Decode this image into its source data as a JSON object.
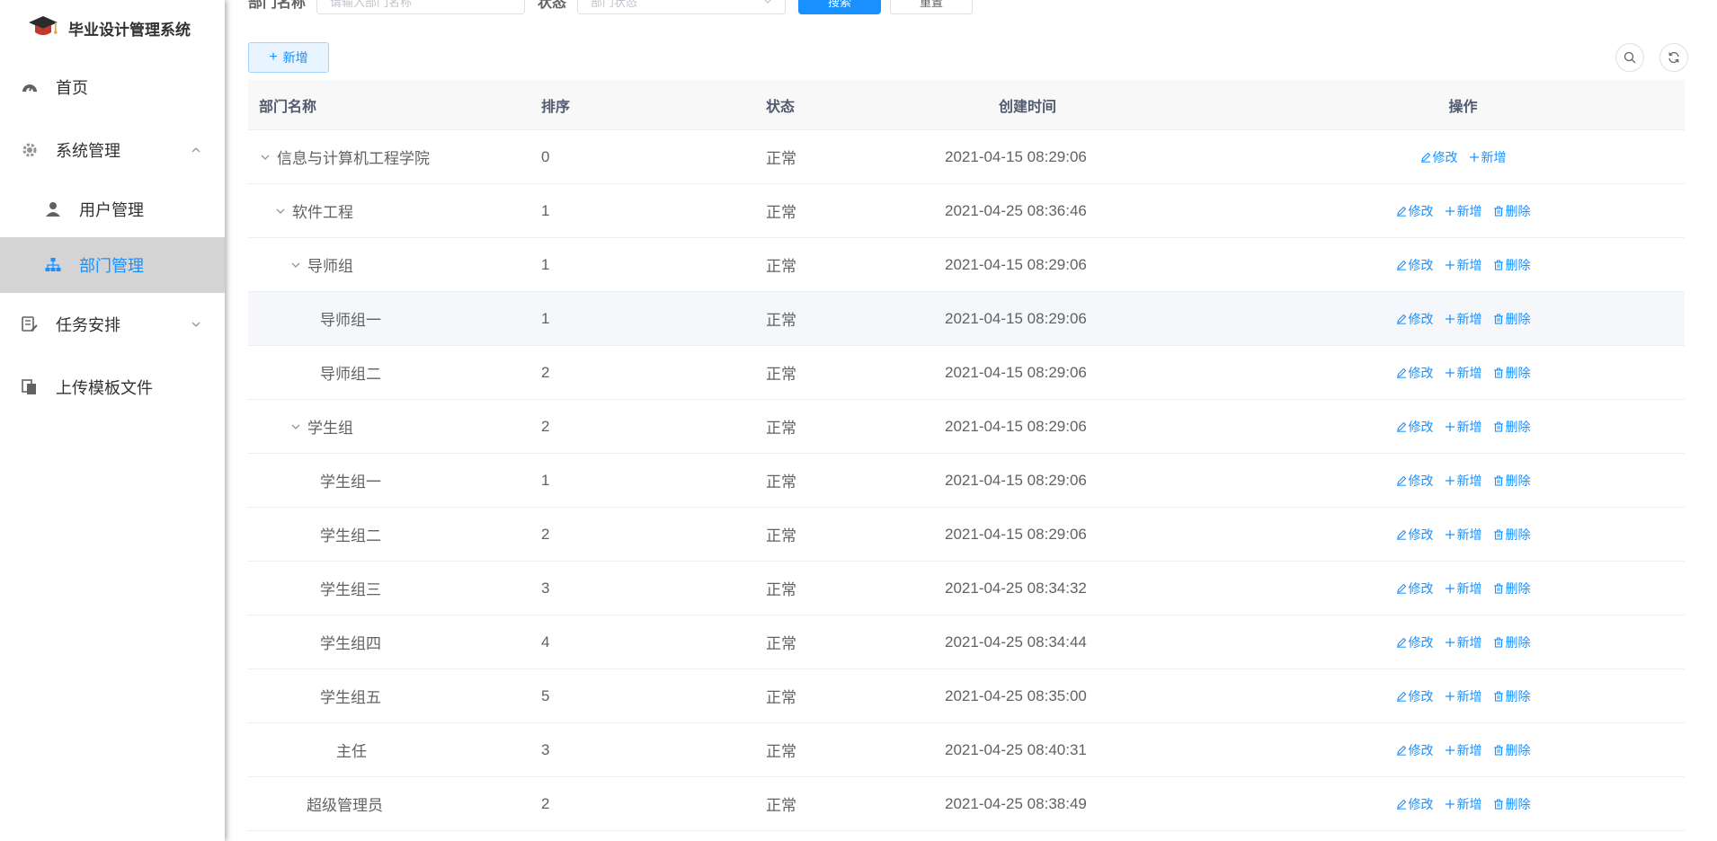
{
  "app": {
    "title": "毕业设计管理系统"
  },
  "sidebar": {
    "items": [
      {
        "label": "首页",
        "icon": "dashboard-icon"
      },
      {
        "label": "系统管理",
        "icon": "gear-icon",
        "expanded": true
      },
      {
        "label": "任务安排",
        "icon": "task-icon",
        "expanded": false
      },
      {
        "label": "上传模板文件",
        "icon": "files-icon"
      }
    ],
    "system_sub": [
      {
        "label": "用户管理",
        "icon": "user-icon",
        "active": false
      },
      {
        "label": "部门管理",
        "icon": "tree-icon",
        "active": true
      }
    ],
    "active_color": "#1890ff",
    "active_bg": "#d4d4d4"
  },
  "search": {
    "name_label": "部门名称",
    "name_placeholder": "请输入部门名称",
    "status_label": "状态",
    "status_placeholder": "部门状态",
    "search_button": "搜索",
    "reset_button": "重置"
  },
  "toolbar": {
    "add_label": "新增"
  },
  "table": {
    "columns": {
      "name": "部门名称",
      "sort": "排序",
      "status": "状态",
      "created": "创建时间",
      "ops": "操作"
    },
    "op_labels": {
      "edit": "修改",
      "add": "新增",
      "delete": "删除"
    },
    "rows": [
      {
        "name": "信息与计算机工程学院",
        "level": 0,
        "expandable": true,
        "sort": "0",
        "status": "正常",
        "created": "2021-04-15 08:29:06",
        "deletable": false
      },
      {
        "name": "软件工程",
        "level": 1,
        "expandable": true,
        "sort": "1",
        "status": "正常",
        "created": "2021-04-25 08:36:46",
        "deletable": true
      },
      {
        "name": "导师组",
        "level": 2,
        "expandable": true,
        "sort": "1",
        "status": "正常",
        "created": "2021-04-15 08:29:06",
        "deletable": true
      },
      {
        "name": "导师组一",
        "level": 3,
        "expandable": false,
        "sort": "1",
        "status": "正常",
        "created": "2021-04-15 08:29:06",
        "deletable": true
      },
      {
        "name": "导师组二",
        "level": 3,
        "expandable": false,
        "sort": "2",
        "status": "正常",
        "created": "2021-04-15 08:29:06",
        "deletable": true
      },
      {
        "name": "学生组",
        "level": 2,
        "expandable": true,
        "sort": "2",
        "status": "正常",
        "created": "2021-04-15 08:29:06",
        "deletable": true
      },
      {
        "name": "学生组一",
        "level": 3,
        "expandable": false,
        "sort": "1",
        "status": "正常",
        "created": "2021-04-15 08:29:06",
        "deletable": true
      },
      {
        "name": "学生组二",
        "level": 3,
        "expandable": false,
        "sort": "2",
        "status": "正常",
        "created": "2021-04-15 08:29:06",
        "deletable": true
      },
      {
        "name": "学生组三",
        "level": 3,
        "expandable": false,
        "sort": "3",
        "status": "正常",
        "created": "2021-04-25 08:34:32",
        "deletable": true
      },
      {
        "name": "学生组四",
        "level": 3,
        "expandable": false,
        "sort": "4",
        "status": "正常",
        "created": "2021-04-25 08:34:44",
        "deletable": true
      },
      {
        "name": "学生组五",
        "level": 3,
        "expandable": false,
        "sort": "5",
        "status": "正常",
        "created": "2021-04-25 08:35:00",
        "deletable": true
      },
      {
        "name": "主任",
        "level": 2,
        "expandable": false,
        "sort": "3",
        "status": "正常",
        "created": "2021-04-25 08:40:31",
        "deletable": true
      },
      {
        "name": "超级管理员",
        "level": 1,
        "expandable": false,
        "sort": "2",
        "status": "正常",
        "created": "2021-04-25 08:38:49",
        "deletable": true
      }
    ]
  }
}
